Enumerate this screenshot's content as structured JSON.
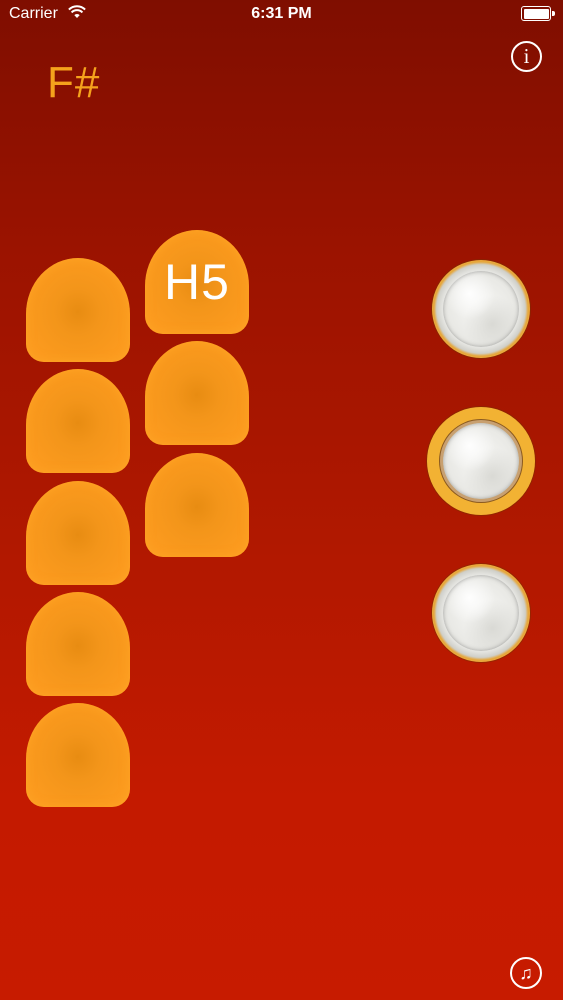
{
  "status_bar": {
    "carrier": "Carrier",
    "time": "6:31 PM",
    "battery_level": 1.0
  },
  "note": "F#",
  "info_button": {
    "icon": "info-icon",
    "glyph": "i"
  },
  "keys": [
    {
      "label": ""
    },
    {
      "label": ""
    },
    {
      "label": ""
    },
    {
      "label": ""
    },
    {
      "label": ""
    },
    {
      "label": "H5"
    },
    {
      "label": ""
    },
    {
      "label": ""
    }
  ],
  "valves": [
    {
      "state": "inactive"
    },
    {
      "state": "active"
    },
    {
      "state": "inactive"
    }
  ],
  "music_button": {
    "icon": "music-note-icon",
    "glyph": "♫"
  },
  "colors": {
    "background_top": "#7f0e00",
    "background_bottom": "#c71b00",
    "key_orange": "#fb9a1e",
    "note_label": "#f5a21c",
    "valve_ring": "#f2b233"
  }
}
